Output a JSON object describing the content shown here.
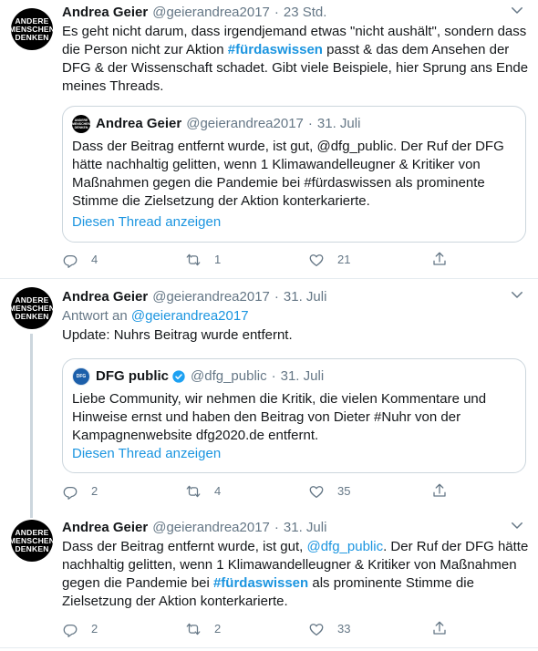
{
  "tweets": [
    {
      "avatar": [
        "ANDERE",
        "MENSCHEN",
        "DENKEN"
      ],
      "name": "Andrea Geier",
      "handle": "@geierandrea2017",
      "dot": "·",
      "time": "23 Std.",
      "text_lines": [
        [
          "Es geht nicht darum, dass irgendjemand etwas \"nicht aushält\", sondern dass"
        ],
        [
          "die Person nicht zur Aktion ",
          "#fürdaswissen",
          " passt & das dem Ansehen der"
        ],
        [
          "DFG & der Wissenschaft schadet. Gibt viele Beispiele, hier Sprung ans Ende"
        ],
        [
          "meines Threads."
        ]
      ],
      "quote": {
        "avatar": [
          "ANDERE",
          "MENSCHEN",
          "DENKEN"
        ],
        "name": "Andrea Geier",
        "handle": "@geierandrea2017",
        "dot": "·",
        "time": "31. Juli",
        "lines": [
          "Dass der Beitrag entfernt wurde, ist gut, @dfg_public. Der Ruf der DFG",
          "hätte nachhaltig gelitten, wenn 1 Klimawandelleugner & Kritiker von",
          "Maßnahmen gegen die Pandemie bei #fürdaswissen als prominente",
          "Stimme die Zielsetzung der Aktion konterkarierte."
        ],
        "show_thread": "Diesen Thread anzeigen"
      },
      "actions": {
        "replies": "4",
        "retweets": "1",
        "likes": "21"
      }
    },
    {
      "avatar": [
        "ANDERE",
        "MENSCHEN",
        "DENKEN"
      ],
      "name": "Andrea Geier",
      "handle": "@geierandrea2017",
      "dot": "·",
      "time": "31. Juli",
      "reply_prefix": "Antwort an ",
      "reply_handle": "@geierandrea2017",
      "text": "Update: Nuhrs Beitrag wurde entfernt.",
      "quote": {
        "avatar": [
          "DFG"
        ],
        "name": "DFG public",
        "handle": "@dfg_public",
        "dot": "·",
        "time": "31. Juli",
        "lines": [
          "Liebe Community, wir nehmen die Kritik, die vielen Kommentare und",
          "Hinweise ernst und haben den Beitrag von Dieter #Nuhr von der",
          "Kampagnenwebsite dfg2020.de entfernt."
        ],
        "show_thread": "Diesen Thread anzeigen"
      },
      "actions": {
        "replies": "2",
        "retweets": "4",
        "likes": "35"
      }
    },
    {
      "avatar": [
        "ANDERE",
        "MENSCHEN",
        "DENKEN"
      ],
      "name": "Andrea Geier",
      "handle": "@geierandrea2017",
      "dot": "·",
      "time": "31. Juli",
      "text_lines": [
        [
          "Dass der Beitrag entfernt wurde, ist gut, ",
          "@dfg_public",
          ". Der Ruf der DFG hätte"
        ],
        [
          "nachhaltig gelitten, wenn 1 Klimawandelleugner & Kritiker von Maßnahmen"
        ],
        [
          "gegen die Pandemie bei ",
          "#fürdaswissen",
          " als prominente Stimme die"
        ],
        [
          "Zielsetzung der Aktion konterkarierte."
        ]
      ],
      "actions": {
        "replies": "2",
        "retweets": "2",
        "likes": "33"
      }
    }
  ],
  "icons": {
    "reply": "reply-icon",
    "retweet": "retweet-icon",
    "like": "like-icon",
    "share": "share-icon",
    "caret": "chevron-down-icon",
    "verified": "verified-badge-icon"
  },
  "colors": {
    "link": "#1b95e0",
    "muted": "#657786",
    "border": "#ccd6dd",
    "verified": "#1da1f2"
  }
}
